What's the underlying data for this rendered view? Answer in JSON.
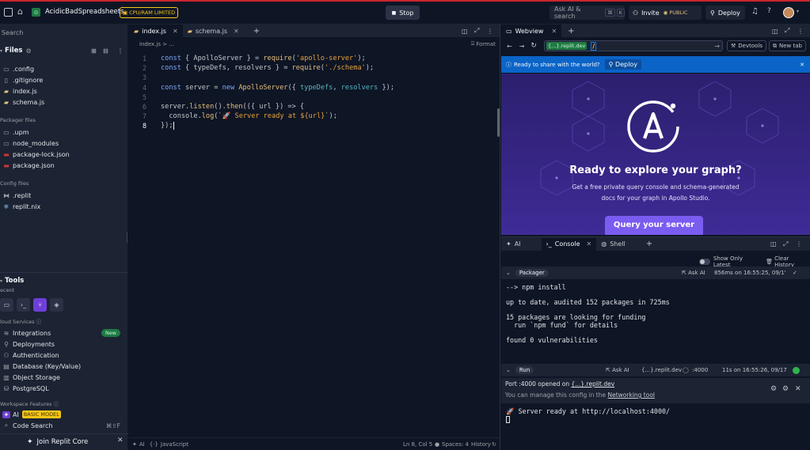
{
  "topbar": {
    "project_name": "AcidicBadSpreadsheets",
    "limit_badge": "CPU/RAM LIMITED",
    "stop_label": "Stop",
    "search_label": "Ask AI & search",
    "kbd_cmd": "⌘",
    "kbd_k": "K",
    "invite_label": "Invite",
    "public_label": "PUBLIC",
    "deploy_label": "Deploy",
    "help_label": "?"
  },
  "sidebar": {
    "search_placeholder": "Search",
    "files_title": "Files",
    "files": [
      {
        "name": ".config",
        "icon": "folder-icon"
      },
      {
        "name": ".gitignore",
        "icon": "file-icon"
      },
      {
        "name": "index.js",
        "icon": "js-file-icon"
      },
      {
        "name": "schema.js",
        "icon": "js-file-icon"
      }
    ],
    "packager_title": "Packager files",
    "packager_files": [
      {
        "name": ".upm",
        "icon": "folder-icon"
      },
      {
        "name": "node_modules",
        "icon": "folder-icon"
      },
      {
        "name": "package-lock.json",
        "icon": "npm-icon"
      },
      {
        "name": "package.json",
        "icon": "npm-icon"
      }
    ],
    "config_title": "Config files",
    "config_files": [
      {
        "name": ".replit",
        "icon": "replit-icon"
      },
      {
        "name": "replit.nix",
        "icon": "nix-icon"
      }
    ],
    "tools_title": "Tools",
    "recent_label": "ecent",
    "cloud_label": "loud Services",
    "cloud_items": [
      {
        "name": "Integrations",
        "badge": "New"
      },
      {
        "name": "Deployments"
      },
      {
        "name": "Authentication"
      },
      {
        "name": "Database (Key/Value)"
      },
      {
        "name": "Object Storage"
      },
      {
        "name": "PostgreSQL"
      }
    ],
    "workspace_label": "Workspace Features",
    "ai_label": "AI",
    "ai_badge": "BASIC MODEL",
    "code_search_label": "Code Search",
    "code_search_kbd": "⌘⇧F",
    "join_label": "Join Replit Core"
  },
  "editor": {
    "tabs": [
      {
        "label": "index.js",
        "active": true
      },
      {
        "label": "schema.js",
        "active": false
      }
    ],
    "breadcrumb": "index.js  >  ...",
    "format_label": "Format",
    "lines": [
      "const { ApolloServer } = require('apollo-server');",
      "const { typeDefs, resolvers } = require('./schema');",
      "",
      "const server = new ApolloServer({ typeDefs, resolvers });",
      "",
      "server.listen().then(({ url }) => {",
      "  console.log(`🚀 Server ready at ${url}`);",
      "});"
    ],
    "status": {
      "ai": "AI",
      "lang": "JavaScript",
      "position": "Ln 8, Col 5",
      "spaces": "Spaces: 4",
      "history": "History"
    }
  },
  "webview": {
    "tab_label": "Webview",
    "url_domain": "{...}.replit.dev",
    "url_path": "/",
    "devtools_label": "Devtools",
    "newtab_label": "New tab",
    "banner_text": "Ready to share with the world?",
    "banner_deploy": "Deploy",
    "hero_title": "Ready to explore your graph?",
    "hero_sub1": "Get a free private query console and schema-generated",
    "hero_sub2": "docs for your graph in Apollo Studio.",
    "hero_button": "Query your server"
  },
  "console": {
    "tabs": [
      {
        "label": "AI"
      },
      {
        "label": "Console",
        "active": true
      },
      {
        "label": "Shell"
      }
    ],
    "show_only_latest": "Show Only Latest",
    "clear_history": "Clear History",
    "packager_label": "Packager",
    "ask_ai": "Ask AI",
    "packager_time": "856ms on 16:55:25, 09/1'",
    "packager_output": [
      "--> npm install",
      "",
      "up to date, audited 152 packages in 725ms",
      "",
      "15 packages are looking for funding",
      "  run `npm fund` for details",
      "",
      "found 0 vulnerabilities"
    ],
    "run_label": "Run",
    "run_domain": "{...}.replit.dev",
    "run_port": ":4000",
    "run_time": "11s on 16:55:26, 09/17",
    "port_msg_prefix": "Port :4000 opened on ",
    "port_msg_link": "{...}.replit.dev",
    "manage_prefix": "You can manage this config in the ",
    "manage_link": "Networking tool",
    "run_output": "🚀 Server ready at http://localhost:4000/"
  },
  "colors": {
    "accent": "#0079f2",
    "deploy_banner": "#0b64c8",
    "hero_bg": "#3f2b96",
    "hero_button": "#7b5cf0",
    "new_badge": "#1f7a43",
    "limit_badge": "#f5c518"
  }
}
